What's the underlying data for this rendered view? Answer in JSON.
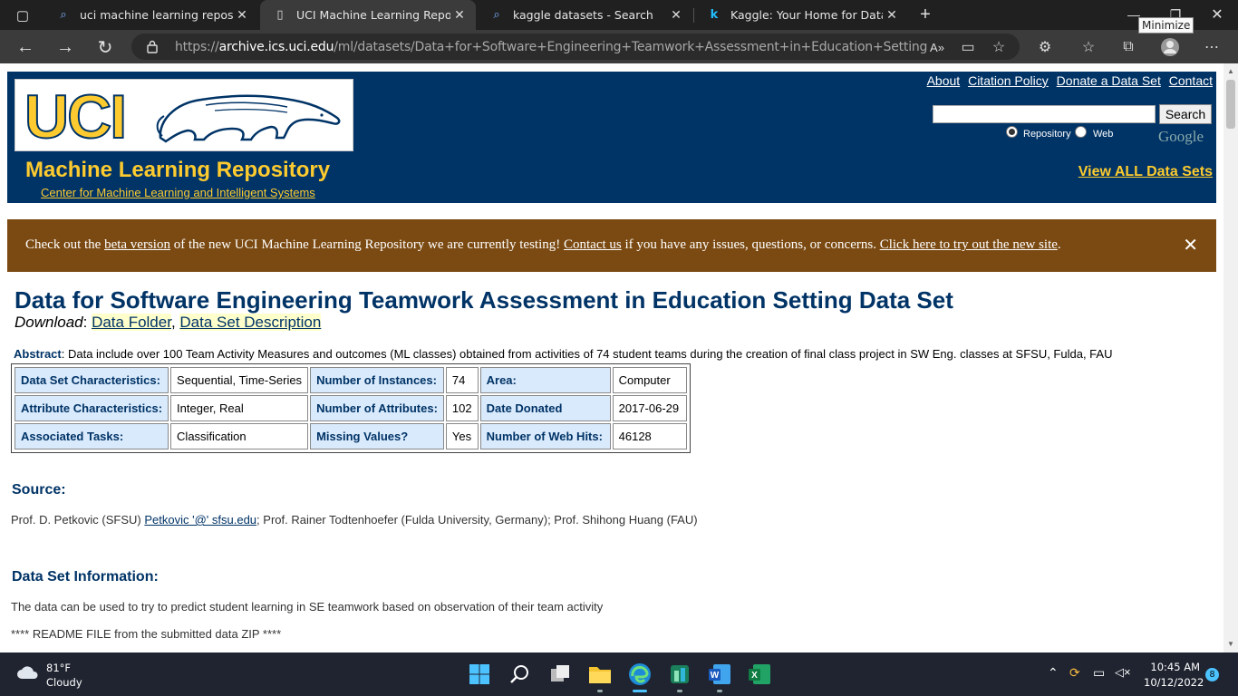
{
  "browser": {
    "tabs": [
      {
        "label": "uci machine learning repository - ",
        "icon": "search-icon"
      },
      {
        "label": "UCI Machine Learning Repository",
        "icon": "page-icon"
      },
      {
        "label": "kaggle datasets - Search",
        "icon": "search-icon"
      },
      {
        "label": "Kaggle: Your Home for Data Scie",
        "icon": "kaggle-icon"
      }
    ],
    "url_prefix": "https://",
    "url_host": "archive.ics.uci.edu",
    "url_path": "/ml/datasets/Data+for+Software+Engineering+Teamwork+Assessment+in+Education+Setting",
    "tooltip": "Minimize"
  },
  "header": {
    "logo_text": "UCI",
    "repo_title": "Machine Learning Repository",
    "center_link": "Center for Machine Learning and Intelligent Systems",
    "links": [
      "About",
      "Citation Policy",
      "Donate a Data Set",
      "Contact"
    ],
    "search_button": "Search",
    "radio_repository": "Repository",
    "radio_web": "Web",
    "google_label": "Google",
    "view_all": "View ALL Data Sets"
  },
  "banner": {
    "t1": "Check out the ",
    "link1": "beta version",
    "t2": " of the new UCI Machine Learning Repository we are currently testing! ",
    "link2": "Contact us",
    "t3": " if you have any issues, questions, or concerns. ",
    "link3": "Click here to try out the new site",
    "t4": ".",
    "close": "✕"
  },
  "dataset": {
    "title": "Data for Software Engineering Teamwork Assessment in Education Setting Data Set",
    "download_label": "Download",
    "download_sep": ": ",
    "data_folder": "Data Folder",
    "comma": ", ",
    "description_link": "Data Set Description",
    "abstract_label": "Abstract",
    "abstract_text": ": Data include over 100 Team Activity Measures and outcomes (ML classes) obtained from activities of 74 student teams during the creation of final class project in SW Eng. classes at SFSU, Fulda, FAU",
    "characteristics": [
      [
        "Data Set Characteristics:",
        "Sequential, Time-Series",
        "Number of Instances:",
        "74",
        "Area:",
        "Computer"
      ],
      [
        "Attribute Characteristics:",
        "Integer, Real",
        "Number of Attributes:",
        "102",
        "Date Donated",
        "2017-06-29"
      ],
      [
        "Associated Tasks:",
        "Classification",
        "Missing Values?",
        "Yes",
        "Number of Web Hits:",
        "46128"
      ]
    ],
    "source_heading": "Source:",
    "source_t1": "Prof. D. Petkovic (SFSU) ",
    "source_link": "Petkovic '@' sfsu.edu",
    "source_t2": "; Prof. Rainer Todtenhoefer (Fulda University, Germany); Prof. Shihong Huang (FAU)",
    "info_heading": "Data Set Information:",
    "info_p1": "The data can be used to try to predict student learning in SE teamwork based on observation of their team activity",
    "info_p2": "**** README FILE from the submitted data ZIP ****"
  },
  "taskbar": {
    "temp": "81°F",
    "condition": "Cloudy",
    "time": "10:45 AM",
    "date": "10/12/2022",
    "notifications": "8"
  }
}
